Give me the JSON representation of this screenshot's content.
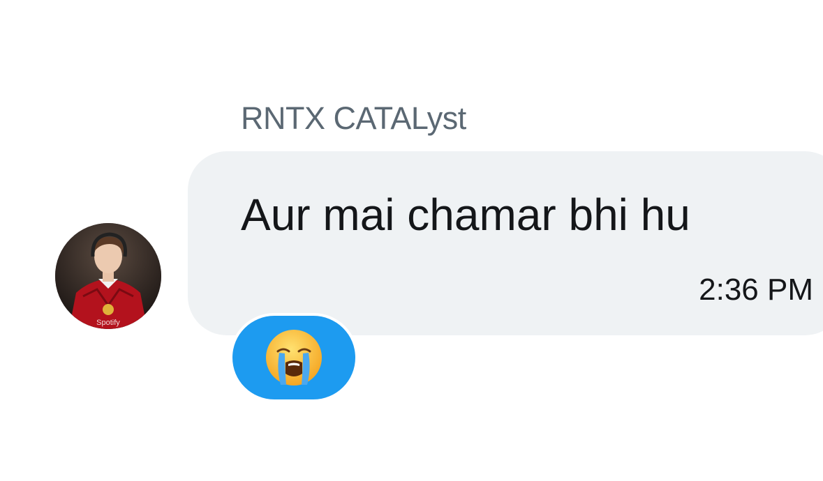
{
  "message": {
    "sender_name": "RNTX CATALyst",
    "text": "Aur mai chamar bhi hu",
    "time": "2:36 PM",
    "reaction_icon": "loudly-crying-face-emoji"
  },
  "colors": {
    "bubble_background": "#eff2f4",
    "sender_name": "#5b6873",
    "message_text": "#141619",
    "reaction_background": "#1d9bf0"
  }
}
